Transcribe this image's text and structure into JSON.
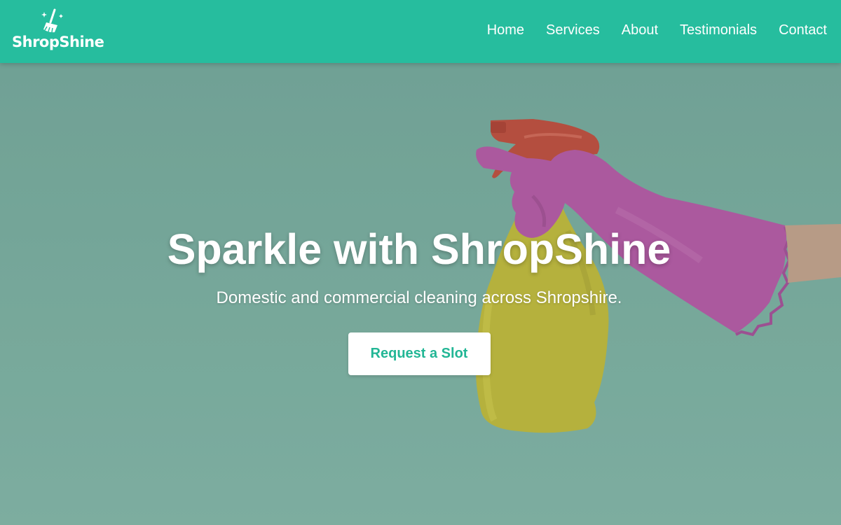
{
  "brand": {
    "name": "ShropShine",
    "logo_icon": "broom-sparkle-icon",
    "header_color": "#26bd9e"
  },
  "nav": {
    "items": [
      {
        "label": "Home"
      },
      {
        "label": "Services"
      },
      {
        "label": "About"
      },
      {
        "label": "Testimonials"
      },
      {
        "label": "Contact"
      }
    ]
  },
  "hero": {
    "title": "Sparkle with ShropShine",
    "subtitle": "Domestic and commercial cleaning across Shropshire.",
    "cta_label": "Request a Slot",
    "image": "gloved-hand-holding-spray-bottle",
    "accent_color": "#22b695"
  }
}
